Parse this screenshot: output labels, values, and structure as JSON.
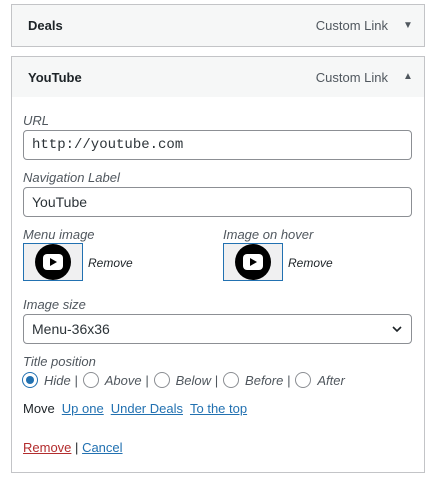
{
  "items": {
    "deals": {
      "title": "Deals",
      "type": "Custom Link"
    },
    "youtube": {
      "title": "YouTube",
      "type": "Custom Link"
    }
  },
  "fields": {
    "url_label": "URL",
    "url_value": "http://youtube.com",
    "nav_label": "Navigation Label",
    "nav_value": "YouTube",
    "menu_image_label": "Menu image",
    "hover_image_label": "Image on hover",
    "remove_label": "Remove",
    "image_size_label": "Image size",
    "image_size_value": "Menu-36x36",
    "title_position_label": "Title position",
    "title_positions": [
      "Hide",
      "Above",
      "Below",
      "Before",
      "After"
    ],
    "title_position_selected": "Hide"
  },
  "move": {
    "label": "Move",
    "up": "Up one",
    "under": "Under Deals",
    "top": "To the top"
  },
  "actions": {
    "remove": "Remove",
    "separator": "|",
    "cancel": "Cancel"
  },
  "colors": {
    "accent": "#2271b1",
    "danger": "#b32d2e",
    "icon_bg": "#000000"
  }
}
